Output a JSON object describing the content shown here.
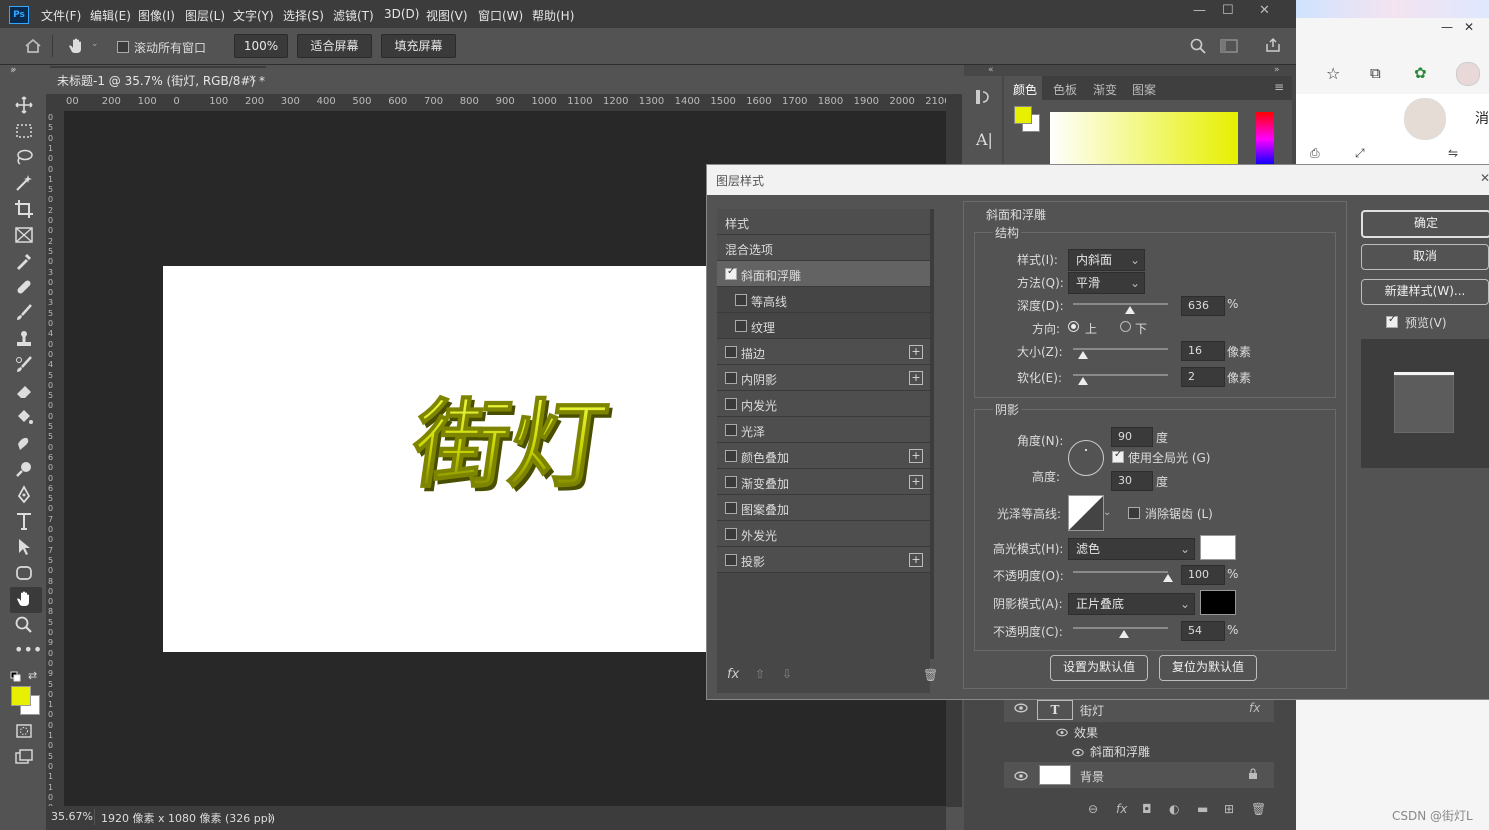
{
  "menubar": {
    "logo": "Ps",
    "items": [
      "文件(F)",
      "编辑(E)",
      "图像(I)",
      "图层(L)",
      "文字(Y)",
      "选择(S)",
      "滤镜(T)",
      "3D(D)",
      "视图(V)",
      "窗口(W)",
      "帮助(H)"
    ],
    "win_min": "—",
    "win_max": "☐",
    "win_close": "✕"
  },
  "options": {
    "scroll_all": "滚动所有窗口",
    "zoom": "100%",
    "fit_screen": "适合屏幕",
    "fill_screen": "填充屏幕"
  },
  "document": {
    "tab_title": "未标题-1 @ 35.7% (街灯, RGB/8#) *",
    "tab_close": "×",
    "canvas_text": "街灯",
    "text_color": "#c8d400",
    "ruler_top": [
      "00",
      "200",
      "100",
      "0",
      "100",
      "200",
      "300",
      "400",
      "500",
      "600",
      "700",
      "800",
      "900",
      "1000",
      "1100",
      "1200",
      "1300",
      "1400",
      "1500",
      "1600",
      "1700",
      "1800",
      "1900",
      "2000",
      "2100"
    ],
    "ruler_left": [
      "0",
      "5",
      "0",
      "1",
      "0",
      "0",
      "1",
      "5",
      "0",
      "2",
      "0",
      "0",
      "2",
      "5",
      "0",
      "3",
      "0",
      "0",
      "3",
      "5",
      "0",
      "4",
      "0",
      "0",
      "4",
      "5",
      "0",
      "5",
      "0",
      "0",
      "5",
      "5",
      "0",
      "6",
      "0",
      "0",
      "6",
      "5",
      "0",
      "7",
      "0",
      "0",
      "7",
      "5",
      "0",
      "8",
      "0",
      "0",
      "8",
      "5",
      "0",
      "9",
      "0",
      "0",
      "9",
      "5",
      "0",
      "1",
      "0",
      "0",
      "1",
      "0",
      "5",
      "0",
      "1",
      "1",
      "0",
      "0"
    ]
  },
  "status": {
    "zoom": "35.67%",
    "info": "1920 像素 x 1080 像素 (326 ppi)",
    "arrow": "〉"
  },
  "colors": {
    "foreground": "#e6f000",
    "background": "#ffffff",
    "accent_dialog": "#f2f2f2"
  },
  "panels": {
    "tabs": [
      "颜色",
      "色板",
      "渐变",
      "图案"
    ]
  },
  "dialog": {
    "title": "图层样式",
    "styles_header": "样式",
    "blend_options": "混合选项",
    "list": [
      {
        "label": "斜面和浮雕",
        "checked": true,
        "plus": false,
        "indent": false,
        "active": true
      },
      {
        "label": "等高线",
        "checked": false,
        "plus": false,
        "indent": true
      },
      {
        "label": "纹理",
        "checked": false,
        "plus": false,
        "indent": true
      },
      {
        "label": "描边",
        "checked": false,
        "plus": true,
        "indent": false
      },
      {
        "label": "内阴影",
        "checked": false,
        "plus": true,
        "indent": false
      },
      {
        "label": "内发光",
        "checked": false,
        "plus": false,
        "indent": false
      },
      {
        "label": "光泽",
        "checked": false,
        "plus": false,
        "indent": false
      },
      {
        "label": "颜色叠加",
        "checked": false,
        "plus": true,
        "indent": false
      },
      {
        "label": "渐变叠加",
        "checked": false,
        "plus": true,
        "indent": false
      },
      {
        "label": "图案叠加",
        "checked": false,
        "plus": false,
        "indent": false
      },
      {
        "label": "外发光",
        "checked": false,
        "plus": false,
        "indent": false
      },
      {
        "label": "投影",
        "checked": false,
        "plus": true,
        "indent": false
      }
    ],
    "fx_label": "fx",
    "bevel": {
      "section_title": "斜面和浮雕",
      "structure_title": "结构",
      "style_label": "样式(I):",
      "style_value": "内斜面",
      "method_label": "方法(Q):",
      "method_value": "平滑",
      "depth_label": "深度(D):",
      "depth_value": "636",
      "depth_unit": "%",
      "depth_level": 0.6,
      "direction_label": "方向:",
      "dir_up": "上",
      "dir_down": "下",
      "size_label": "大小(Z):",
      "size_value": "16",
      "size_unit": "像素",
      "size_level": 0.1,
      "soften_label": "软化(E):",
      "soften_value": "2",
      "soften_unit": "像素",
      "soften_level": 0.1
    },
    "shading": {
      "title": "阴影",
      "angle_label": "角度(N):",
      "angle_value": "90",
      "angle_unit": "度",
      "global_light": "使用全局光 (G)",
      "altitude_label": "高度:",
      "altitude_value": "30",
      "altitude_unit": "度",
      "gloss_label": "光泽等高线:",
      "antialias": "消除锯齿 (L)",
      "highlight_label": "高光模式(H):",
      "highlight_mode": "滤色",
      "highlight_color": "#ffffff",
      "hl_opacity_label": "不透明度(O):",
      "hl_opacity_value": "100",
      "hl_opacity_unit": "%",
      "hl_opacity_level": 1.0,
      "shadow_label": "阴影模式(A):",
      "shadow_mode": "正片叠底",
      "shadow_color": "#000000",
      "sh_opacity_label": "不透明度(C):",
      "sh_opacity_value": "54",
      "sh_opacity_unit": "%",
      "sh_opacity_level": 0.54
    },
    "make_default": "设置为默认值",
    "reset_default": "复位为默认值",
    "ok": "确定",
    "cancel": "取消",
    "new_style": "新建样式(W)...",
    "preview": "预览(V)"
  },
  "layers": {
    "text_layer": "街灯",
    "effects": "效果",
    "bevel": "斜面和浮雕",
    "background": "背景",
    "fx": "fx"
  },
  "browser": {
    "side_text": "消",
    "minimize": "—",
    "close": "✕"
  },
  "watermark": "CSDN @街灯L"
}
